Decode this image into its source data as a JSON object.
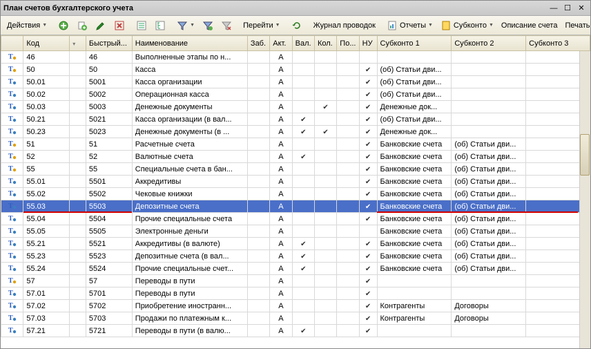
{
  "window": {
    "title": "План счетов бухгалтерского учета"
  },
  "toolbar": {
    "actions": "Действия",
    "goto": "Перейти",
    "journal": "Журнал проводок",
    "reports": "Отчеты",
    "subkonto": "Субконто",
    "desc": "Описание счета",
    "print": "Печать"
  },
  "columns": {
    "code": "Код",
    "quick": "Быстрый...",
    "name": "Наименование",
    "zab": "Заб.",
    "akt": "Акт.",
    "val": "Вал.",
    "kol": "Кол.",
    "po": "По...",
    "nu": "НУ",
    "s1": "Субконто 1",
    "s2": "Субконто 2",
    "s3": "Субконто 3"
  },
  "rows": [
    {
      "icon": "y",
      "code": "46",
      "quick": "46",
      "name": "Выполненные этапы по н...",
      "akt": "А",
      "val": "",
      "kol": "",
      "po": "",
      "nu": "",
      "s1": "",
      "s2": ""
    },
    {
      "icon": "y",
      "code": "50",
      "quick": "50",
      "name": "Касса",
      "akt": "А",
      "val": "",
      "kol": "",
      "po": "",
      "nu": "✔",
      "s1": "(об) Статьи дви...",
      "s2": ""
    },
    {
      "icon": "b",
      "code": "50.01",
      "quick": "5001",
      "name": "Касса организации",
      "akt": "А",
      "val": "",
      "kol": "",
      "po": "",
      "nu": "✔",
      "s1": "(об) Статьи дви...",
      "s2": ""
    },
    {
      "icon": "b",
      "code": "50.02",
      "quick": "5002",
      "name": "Операционная касса",
      "akt": "А",
      "val": "",
      "kol": "",
      "po": "",
      "nu": "✔",
      "s1": "(об) Статьи дви...",
      "s2": ""
    },
    {
      "icon": "b",
      "code": "50.03",
      "quick": "5003",
      "name": "Денежные документы",
      "akt": "А",
      "val": "",
      "kol": "✔",
      "po": "",
      "nu": "✔",
      "s1": "Денежные док...",
      "s2": ""
    },
    {
      "icon": "b",
      "code": "50.21",
      "quick": "5021",
      "name": "Касса организации (в вал...",
      "akt": "А",
      "val": "✔",
      "kol": "",
      "po": "",
      "nu": "✔",
      "s1": "(об) Статьи дви...",
      "s2": ""
    },
    {
      "icon": "b",
      "code": "50.23",
      "quick": "5023",
      "name": "Денежные документы (в ...",
      "akt": "А",
      "val": "✔",
      "kol": "✔",
      "po": "",
      "nu": "✔",
      "s1": "Денежные док...",
      "s2": ""
    },
    {
      "icon": "y",
      "code": "51",
      "quick": "51",
      "name": "Расчетные счета",
      "akt": "А",
      "val": "",
      "kol": "",
      "po": "",
      "nu": "✔",
      "s1": "Банковские счета",
      "s2": "(об) Статьи дви..."
    },
    {
      "icon": "y",
      "code": "52",
      "quick": "52",
      "name": "Валютные счета",
      "akt": "А",
      "val": "✔",
      "kol": "",
      "po": "",
      "nu": "✔",
      "s1": "Банковские счета",
      "s2": "(об) Статьи дви..."
    },
    {
      "icon": "y",
      "code": "55",
      "quick": "55",
      "name": "Специальные счета в бан...",
      "akt": "А",
      "val": "",
      "kol": "",
      "po": "",
      "nu": "✔",
      "s1": "Банковские счета",
      "s2": "(об) Статьи дви..."
    },
    {
      "icon": "b",
      "code": "55.01",
      "quick": "5501",
      "name": "Аккредитивы",
      "akt": "А",
      "val": "",
      "kol": "",
      "po": "",
      "nu": "✔",
      "s1": "Банковские счета",
      "s2": "(об) Статьи дви..."
    },
    {
      "icon": "b",
      "code": "55.02",
      "quick": "5502",
      "name": "Чековые книжки",
      "akt": "А",
      "val": "",
      "kol": "",
      "po": "",
      "nu": "✔",
      "s1": "Банковские счета",
      "s2": "(об) Статьи дви..."
    },
    {
      "icon": "sel",
      "code": "55.03",
      "quick": "5503",
      "name": "Депозитные счета",
      "akt": "А",
      "val": "",
      "kol": "",
      "po": "",
      "nu": "✔",
      "s1": "Банковские счета",
      "s2": "(об) Статьи дви..."
    },
    {
      "icon": "b",
      "code": "55.04",
      "quick": "5504",
      "name": "Прочие специальные счета",
      "akt": "А",
      "val": "",
      "kol": "",
      "po": "",
      "nu": "✔",
      "s1": "Банковские счета",
      "s2": "(об) Статьи дви..."
    },
    {
      "icon": "b",
      "code": "55.05",
      "quick": "5505",
      "name": "Электронные деньги",
      "akt": "А",
      "val": "",
      "kol": "",
      "po": "",
      "nu": "",
      "s1": "Банковские счета",
      "s2": "(об) Статьи дви..."
    },
    {
      "icon": "b",
      "code": "55.21",
      "quick": "5521",
      "name": "Аккредитивы (в валюте)",
      "akt": "А",
      "val": "✔",
      "kol": "",
      "po": "",
      "nu": "✔",
      "s1": "Банковские счета",
      "s2": "(об) Статьи дви..."
    },
    {
      "icon": "b",
      "code": "55.23",
      "quick": "5523",
      "name": "Депозитные счета (в вал...",
      "akt": "А",
      "val": "✔",
      "kol": "",
      "po": "",
      "nu": "✔",
      "s1": "Банковские счета",
      "s2": "(об) Статьи дви..."
    },
    {
      "icon": "b",
      "code": "55.24",
      "quick": "5524",
      "name": "Прочие специальные счет...",
      "akt": "А",
      "val": "✔",
      "kol": "",
      "po": "",
      "nu": "✔",
      "s1": "Банковские счета",
      "s2": "(об) Статьи дви..."
    },
    {
      "icon": "y",
      "code": "57",
      "quick": "57",
      "name": "Переводы в пути",
      "akt": "А",
      "val": "",
      "kol": "",
      "po": "",
      "nu": "✔",
      "s1": "",
      "s2": ""
    },
    {
      "icon": "b",
      "code": "57.01",
      "quick": "5701",
      "name": "Переводы в пути",
      "akt": "А",
      "val": "",
      "kol": "",
      "po": "",
      "nu": "✔",
      "s1": "",
      "s2": ""
    },
    {
      "icon": "b",
      "code": "57.02",
      "quick": "5702",
      "name": "Приобретение иностранн...",
      "akt": "А",
      "val": "",
      "kol": "",
      "po": "",
      "nu": "✔",
      "s1": "Контрагенты",
      "s2": "Договоры"
    },
    {
      "icon": "b",
      "code": "57.03",
      "quick": "5703",
      "name": "Продажи по платежным к...",
      "akt": "А",
      "val": "",
      "kol": "",
      "po": "",
      "nu": "✔",
      "s1": "Контрагенты",
      "s2": "Договоры"
    },
    {
      "icon": "b",
      "code": "57.21",
      "quick": "5721",
      "name": "Переводы в пути (в валю...",
      "akt": "А",
      "val": "✔",
      "kol": "",
      "po": "",
      "nu": "✔",
      "s1": "",
      "s2": ""
    }
  ],
  "selectedIndex": 12
}
